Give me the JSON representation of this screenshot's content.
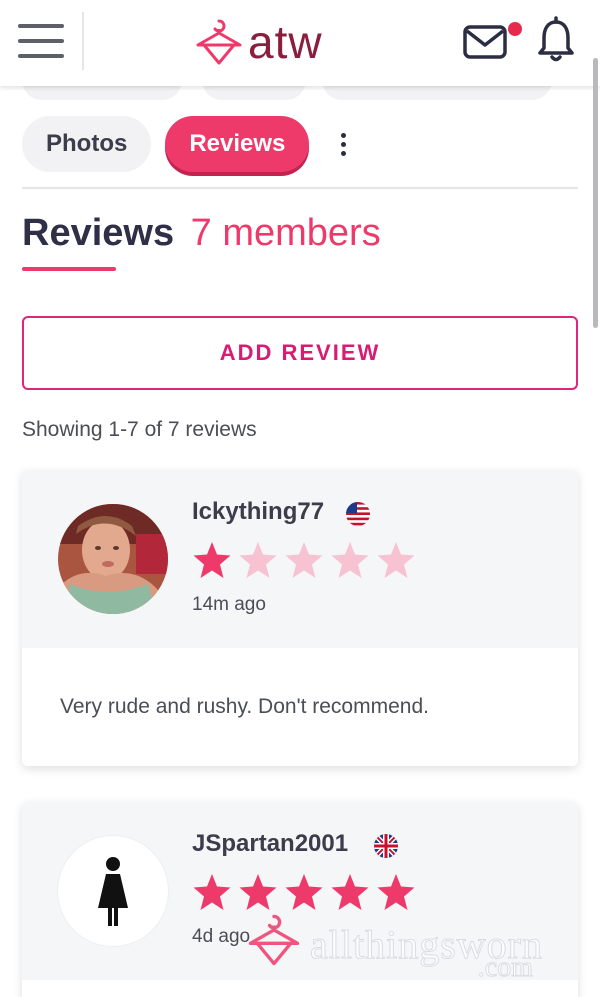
{
  "header": {
    "logo_text": "atw",
    "menu_icon": "hamburger-menu-icon",
    "mail_icon": "mail-icon",
    "notification_icon": "bell-icon",
    "brand_color": "#ee3a6a",
    "logo_color": "#8b1e3f"
  },
  "tabs": [
    {
      "label": "Photos",
      "active": false
    },
    {
      "label": "Reviews",
      "active": true
    }
  ],
  "section": {
    "title": "Reviews",
    "count_label": "7 members"
  },
  "add_review_label": "ADD REVIEW",
  "showing_text": "Showing 1-7 of 7 reviews",
  "reviews": [
    {
      "username": "Ickything77",
      "flag": "us-flag-icon",
      "rating": 1,
      "max_rating": 5,
      "time_ago": "14m ago",
      "text": "Very rude and rushy. Don't recommend."
    },
    {
      "username": "JSpartan2001",
      "flag": "uk-flag-icon",
      "rating": 5,
      "max_rating": 5,
      "time_ago": "4d ago",
      "text": ""
    }
  ],
  "watermark": {
    "text": "allthingsworn",
    "suffix": ".com"
  }
}
